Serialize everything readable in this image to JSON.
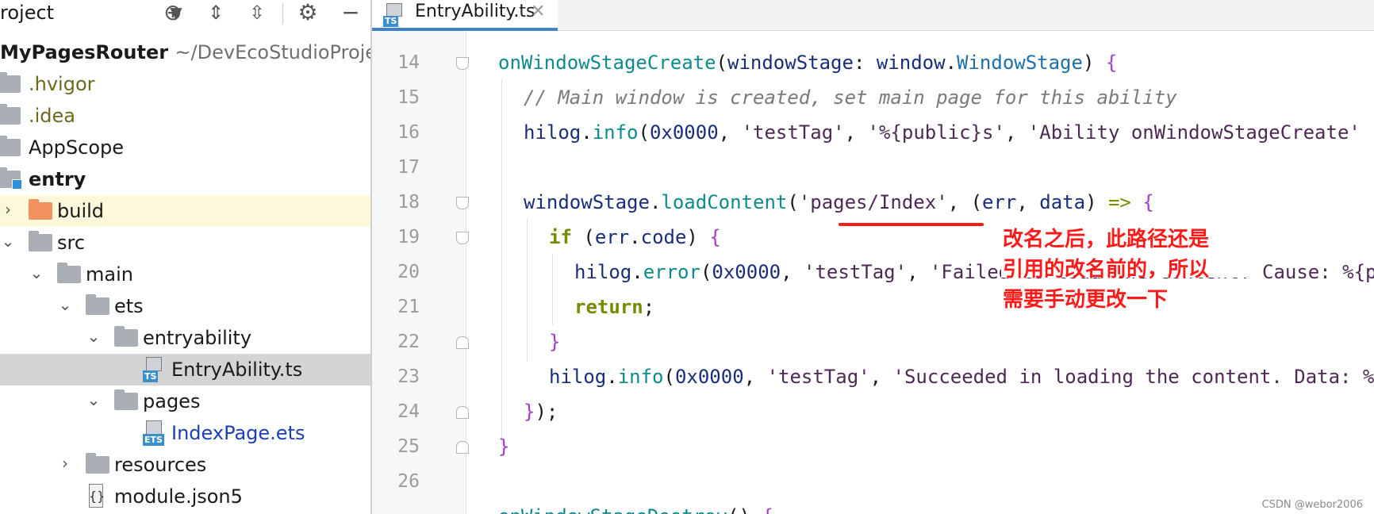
{
  "project_panel": {
    "title": "roject",
    "tree": [
      {
        "label": "MyPagesRouter",
        "path": "~/DevEcoStudioProjec",
        "kind": "project"
      },
      {
        "label": ".hvigor",
        "kind": "folder"
      },
      {
        "label": ".idea",
        "kind": "folder"
      },
      {
        "label": "AppScope",
        "kind": "folder"
      },
      {
        "label": "entry",
        "kind": "module"
      },
      {
        "label": "build",
        "kind": "folder-build"
      },
      {
        "label": "src",
        "kind": "folder"
      },
      {
        "label": "main",
        "kind": "folder"
      },
      {
        "label": "ets",
        "kind": "folder"
      },
      {
        "label": "entryability",
        "kind": "folder"
      },
      {
        "label": "EntryAbility.ts",
        "kind": "file-ts",
        "badge": "TS"
      },
      {
        "label": "pages",
        "kind": "folder"
      },
      {
        "label": "IndexPage.ets",
        "kind": "file-ets",
        "badge": "ETS"
      },
      {
        "label": "resources",
        "kind": "folder"
      },
      {
        "label": "module.json5",
        "kind": "file-json"
      }
    ]
  },
  "editor": {
    "tab": {
      "title": "EntryAbility.ts",
      "badge": "TS"
    },
    "line_numbers": [
      "14",
      "15",
      "16",
      "17",
      "18",
      "19",
      "20",
      "21",
      "22",
      "23",
      "24",
      "25",
      "26"
    ],
    "code": {
      "l14": {
        "a": "onWindowStageCreate",
        "b": "(",
        "c": "windowStage",
        "d": ": ",
        "e": "window",
        "f": ".",
        "g": "WindowStage",
        "h": ") ",
        "i": "{"
      },
      "l15": {
        "a": "// Main window is created, set main page for this ability"
      },
      "l16": {
        "a": "hilog",
        "b": ".",
        "c": "info",
        "d": "(",
        "e": "0x0000",
        "f": ", ",
        "g": "'testTag'",
        "h": ", ",
        "i": "'%{public}s'",
        "j": ", ",
        "k": "'Ability onWindowStageCreate'"
      },
      "l18": {
        "a": "windowStage",
        "b": ".",
        "c": "loadContent",
        "d": "(",
        "e": "'pages/Index'",
        "f": ", ",
        "g": "(",
        "h": "err",
        "i": ", ",
        "j": "data",
        "k": ") ",
        "l": "=>",
        "m": " ",
        "n": "{"
      },
      "l19": {
        "a": "if",
        "b": " (",
        "c": "err",
        "d": ".",
        "e": "code",
        "f": ") ",
        "g": "{"
      },
      "l20": {
        "a": "hilog",
        "b": ".",
        "c": "error",
        "d": "(",
        "e": "0x0000",
        "f": ", ",
        "g": "'testTag'",
        "h": ", ",
        "i": "'Failed to load the content. Cause: %{public}s'"
      },
      "l21": {
        "a": "return",
        "b": ";"
      },
      "l22": {
        "a": "}"
      },
      "l23": {
        "a": "hilog",
        "b": ".",
        "c": "info",
        "d": "(",
        "e": "0x0000",
        "f": ", ",
        "g": "'testTag'",
        "h": ", ",
        "i": "'Succeeded in loading the content. Data: %{public}s'"
      },
      "l24": {
        "a": "}",
        "b": ");"
      },
      "l25": {
        "a": "}"
      },
      "l27": {
        "a": "onWindowStageDestroy",
        "b": "() ",
        "c": "{"
      }
    }
  },
  "annotation": {
    "lines": [
      "改名之后，此路径还是",
      "引用的改名前的，所以",
      "需要手动更改一下"
    ]
  },
  "watermark": "CSDN @webor2006",
  "colors": {
    "annotation": "#ff1a1a",
    "tab_accent": "#4083c9",
    "selection": "#d4d4d4",
    "build_highlight": "#fcf8dc"
  }
}
